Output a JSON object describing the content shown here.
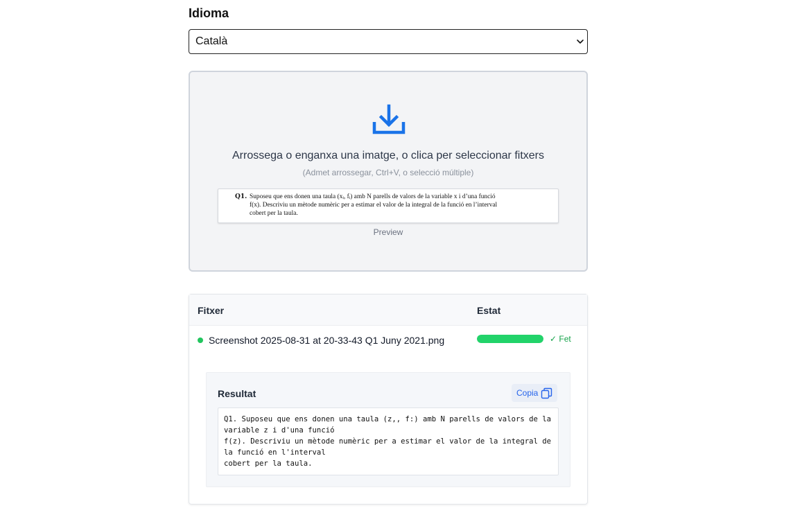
{
  "language": {
    "label": "Idioma",
    "selected": "Català"
  },
  "dropzone": {
    "icon": "download-tray-icon",
    "main_text": "Arrossega o enganxa una imatge, o clica per seleccionar fitxers",
    "hint_text": "(Admet arrossegar, Ctrl+V, o selecció múltiple)",
    "preview": {
      "question_label": "Q1.",
      "lines": [
        "Suposeu que ens donen una taula (xᵢ, fᵢ) amb N parells de valors de la variable x i d’una funció",
        "f(x). Descriviu un mètode numèric per a estimar el valor de la integral de la funció en l’interval",
        "cobert per la taula."
      ],
      "label": "Preview"
    }
  },
  "table": {
    "headers": {
      "file": "Fitxer",
      "status": "Estat"
    },
    "rows": [
      {
        "file_name": "Screenshot 2025-08-31 at 20-33-43 Q1 Juny 2021.png",
        "progress": 1.0,
        "status_text": "✓ Fet",
        "status_color": "#16a34a"
      }
    ],
    "result": {
      "title": "Resultat",
      "copy_label": "Copia",
      "copy_icon": "copy-icon",
      "text": "Q1. Suposeu que ens donen una taula (z,, f:) amb N parells de valors de la variable z i d'una funció\nf(z). Descriviu un mètode numèric per a estimar el valor de la integral de la funció en l'interval\ncobert per la taula."
    }
  },
  "colors": {
    "accent": "#1a73e8",
    "success": "#22c55e",
    "progress_fill": "#22d36a"
  }
}
